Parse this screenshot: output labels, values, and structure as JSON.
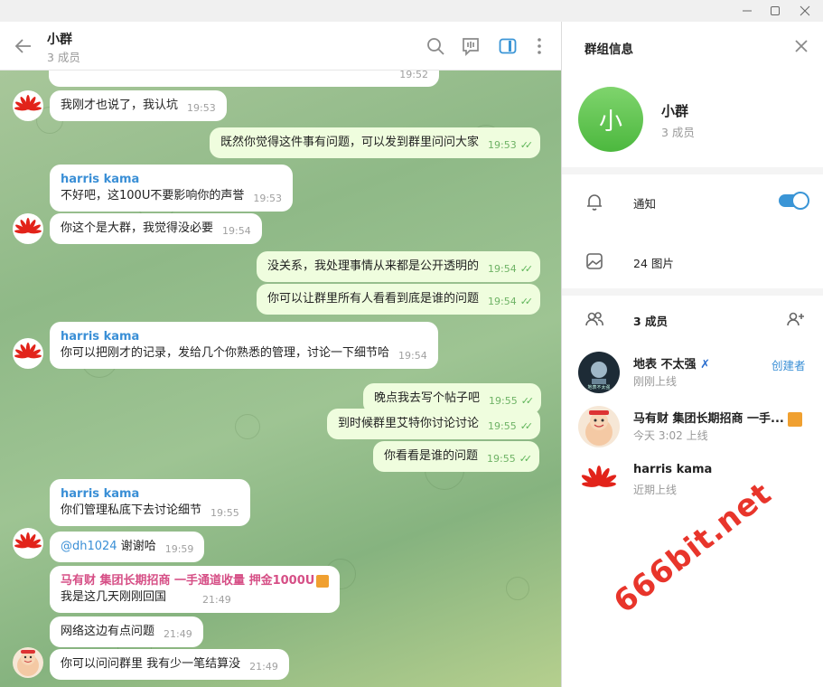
{
  "window": {
    "min": "—",
    "max": "☐",
    "close": "✕"
  },
  "header": {
    "title": "小群",
    "subtitle": "3 成员"
  },
  "messages": [
    {
      "time": "19:52"
    },
    {
      "text": "我刚才也说了，我认坑",
      "time": "19:53"
    },
    {
      "text": "既然你觉得这件事有问题，可以发到群里问问大家",
      "time": "19:53"
    },
    {
      "name": "harris kama",
      "text": "不好吧，这100U不要影响你的声誉",
      "time": "19:53"
    },
    {
      "text": "你这个是大群，我觉得没必要",
      "time": "19:54"
    },
    {
      "text": "没关系，我处理事情从来都是公开透明的",
      "time": "19:54"
    },
    {
      "text": "你可以让群里所有人看看到底是谁的问题",
      "time": "19:54"
    },
    {
      "name": "harris kama",
      "text": "你可以把刚才的记录，发给几个你熟悉的管理，讨论一下细节哈",
      "time": "19:54"
    },
    {
      "text": "晚点我去写个帖子吧",
      "time": "19:55"
    },
    {
      "text": "到时候群里艾特你讨论讨论",
      "time": "19:55"
    },
    {
      "text": "你看看是谁的问题",
      "time": "19:55"
    },
    {
      "name": "harris kama",
      "text": "你们管理私底下去讨论细节",
      "time": "19:55"
    },
    {
      "mention": "@dh1024",
      "text": " 谢谢哈",
      "time": "19:59"
    },
    {
      "name": "马有财 集团长期招商 一手通道收量 押金1000U",
      "text": "我是这几天刚刚回国",
      "time": "21:49"
    },
    {
      "text": "网络这边有点问题",
      "time": "21:49"
    },
    {
      "text": "你可以问问群里 我有少一笔结算没",
      "time": "21:49"
    }
  ],
  "panel": {
    "title": "群组信息",
    "group_initial": "小",
    "group_name": "小群",
    "group_members": "3 成员",
    "notify_label": "通知",
    "notify_on": true,
    "photos_label": "24 图片",
    "members_label": "3 成员",
    "members": [
      {
        "name": "地表 不太强",
        "status": "刚刚上线",
        "role": "创建者"
      },
      {
        "name": "马有财 集团长期招商 一手...",
        "status": "今天 3:02 上线"
      },
      {
        "name": "harris kama",
        "status": "近期上线"
      }
    ]
  },
  "watermark": "666bit.net",
  "colors": {
    "name_blue": "#3a8fd6",
    "name_pink": "#d64f86",
    "accent": "#3a95d6",
    "group_green": "#5cc04b"
  }
}
